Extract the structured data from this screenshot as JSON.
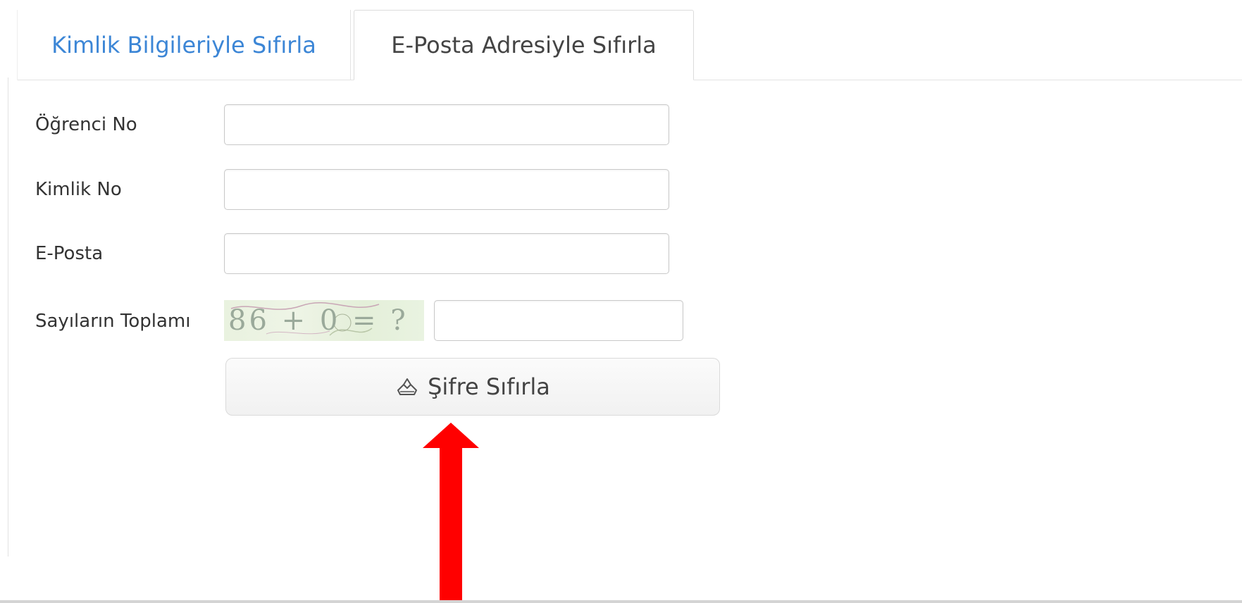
{
  "tabs": [
    {
      "label": "Kimlik Bilgileriyle Sıfırla",
      "active": false
    },
    {
      "label": "E-Posta Adresiyle Sıfırla",
      "active": true
    }
  ],
  "form": {
    "student_no_label": "Öğrenci No",
    "student_no_value": "",
    "id_no_label": "Kimlik No",
    "id_no_value": "",
    "email_label": "E-Posta",
    "email_value": "",
    "captcha_label": "Sayıların Toplamı",
    "captcha_text": "86 + 0 = ?",
    "captcha_value": ""
  },
  "submit": {
    "label": "Şifre Sıfırla",
    "icon": "reset-icon"
  },
  "colors": {
    "tab_active_text": "#444444",
    "tab_inactive_text": "#3c86d6",
    "arrow": "#ff0000"
  }
}
